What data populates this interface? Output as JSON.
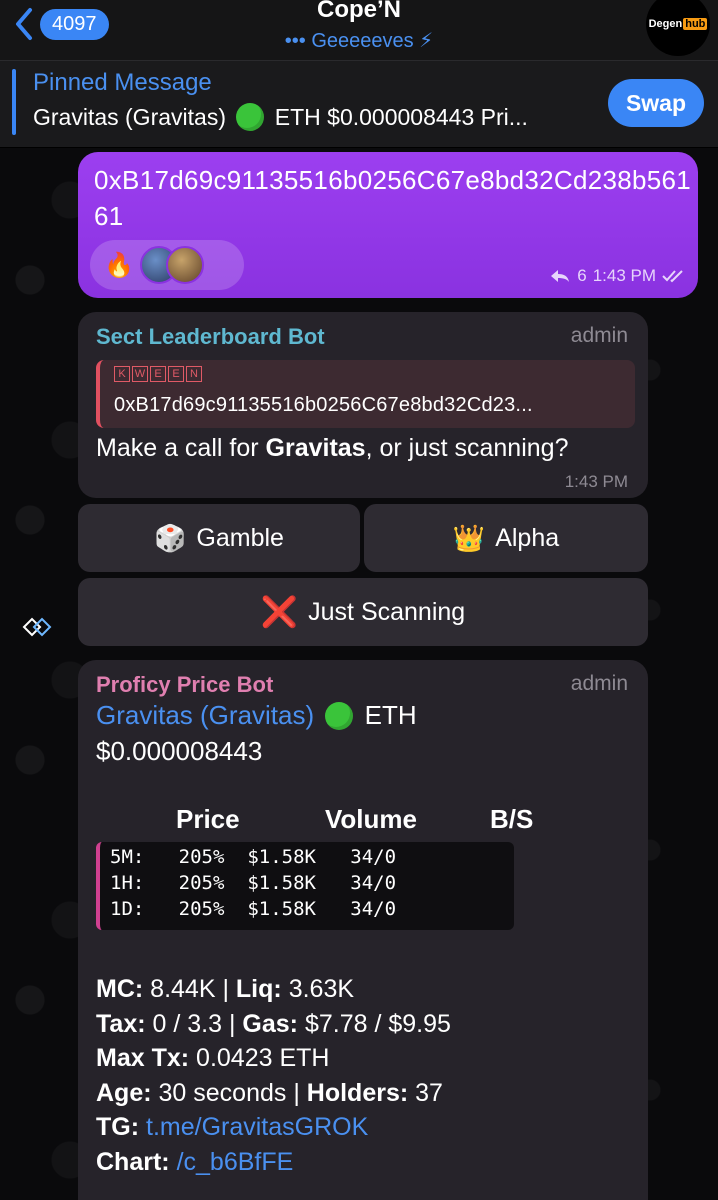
{
  "header": {
    "back_count": "4097",
    "title": "Cope’N",
    "subtitle": "••• Geeeeeves ⚡",
    "avatar_word": "Degen",
    "avatar_hub": "hub"
  },
  "pinned": {
    "label": "Pinned Message",
    "text_before": "Gravitas (Gravitas)",
    "text_after": "ETH $0.000008443 Pri...",
    "swap_label": "Swap"
  },
  "outgoing": {
    "text": "0xB17d69c91135516b0256C67e8bd32Cd238b56161",
    "reaction_emoji": "🔥",
    "reply_count": "6",
    "time": "1:43 PM"
  },
  "leaderboard_msg": {
    "bot_name": "Sect Leaderboard Bot",
    "bot_color": "#5fb8d0",
    "admin": "admin",
    "quote_badge": [
      "K",
      "W",
      "E",
      "E",
      "N"
    ],
    "quote_text": "0xB17d69c91135516b0256C67e8bd32Cd23...",
    "body_prefix": "Make a call for ",
    "body_bold": "Gravitas",
    "body_suffix": ", or just scanning?",
    "time": "1:43 PM"
  },
  "keyboard": {
    "gamble_emoji": "🎲",
    "gamble_label": "Gamble",
    "alpha_emoji": "👑",
    "alpha_label": "Alpha",
    "scan_icon": "❌",
    "scan_label": "Just Scanning"
  },
  "price_msg": {
    "bot_name": "Proficy Price Bot",
    "bot_color": "#e07fb0",
    "admin": "admin",
    "token_link": "Gravitas (Gravitas)",
    "chain": "ETH",
    "price": "$0.000008443",
    "table_headers": [
      "Price",
      "Volume",
      "B/S"
    ],
    "table_rows": [
      {
        "period": "5M:",
        "price": "205%",
        "volume": "$1.58K",
        "bs": "34/0"
      },
      {
        "period": "1H:",
        "price": "205%",
        "volume": "$1.58K",
        "bs": "34/0"
      },
      {
        "period": "1D:",
        "price": "205%",
        "volume": "$1.58K",
        "bs": "34/0"
      }
    ],
    "mc_label": "MC:",
    "mc_value": "8.44K",
    "liq_label": "Liq:",
    "liq_value": "3.63K",
    "tax_label": "Tax:",
    "tax_value": "0 / 3.3",
    "gas_label": "Gas:",
    "gas_value": "$7.78 / $9.95",
    "maxtx_label": "Max Tx:",
    "maxtx_value": "0.0423 ETH",
    "age_label": "Age:",
    "age_value": "30 seconds",
    "holders_label": "Holders:",
    "holders_value": "37",
    "tg_label": "TG:",
    "tg_value": "t.me/GravitasGROK",
    "chart_label": "Chart:",
    "chart_value": "/c_b6BfFE"
  },
  "icons": {
    "back": "chevron-left-icon",
    "forward": "diamond-forward-icon",
    "reply": "reply-arrow-icon",
    "read": "double-check-icon"
  }
}
